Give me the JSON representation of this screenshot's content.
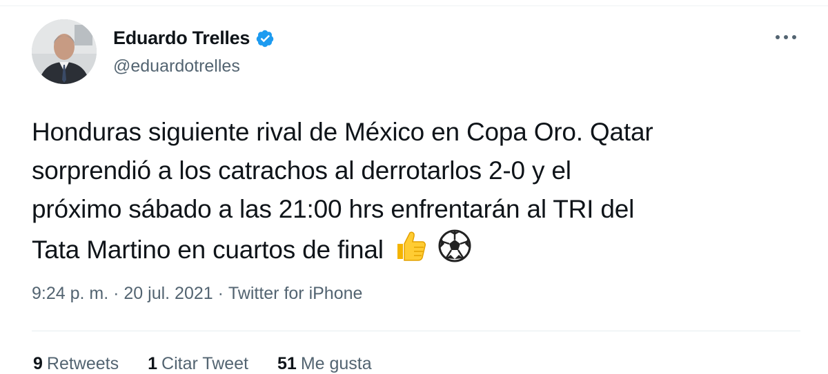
{
  "tweet": {
    "author": {
      "display_name": "Eduardo Trelles",
      "handle": "@eduardotrelles",
      "verified": true
    },
    "text_lines": [
      "Honduras siguiente rival de México en Copa Oro. Qatar",
      "sorprendió a los catrachos al derrotarlos 2-0 y el",
      "próximo sábado a las 21:00 hrs enfrentarán al TRI del",
      "Tata Martino en cuartos de final"
    ],
    "emojis": [
      "thumbs-up",
      "soccer-ball"
    ],
    "meta": {
      "time": "9:24 p. m.",
      "separator": " · ",
      "date": "20 jul. 2021",
      "source": "Twitter for iPhone"
    },
    "stats": [
      {
        "count": "9",
        "label": "Retweets"
      },
      {
        "count": "1",
        "label": "Citar Tweet"
      },
      {
        "count": "51",
        "label": "Me gusta"
      }
    ]
  },
  "colors": {
    "text": "#0f1419",
    "secondary": "#536471",
    "verified": "#1d9bf0",
    "divider": "#e6ecf0"
  }
}
